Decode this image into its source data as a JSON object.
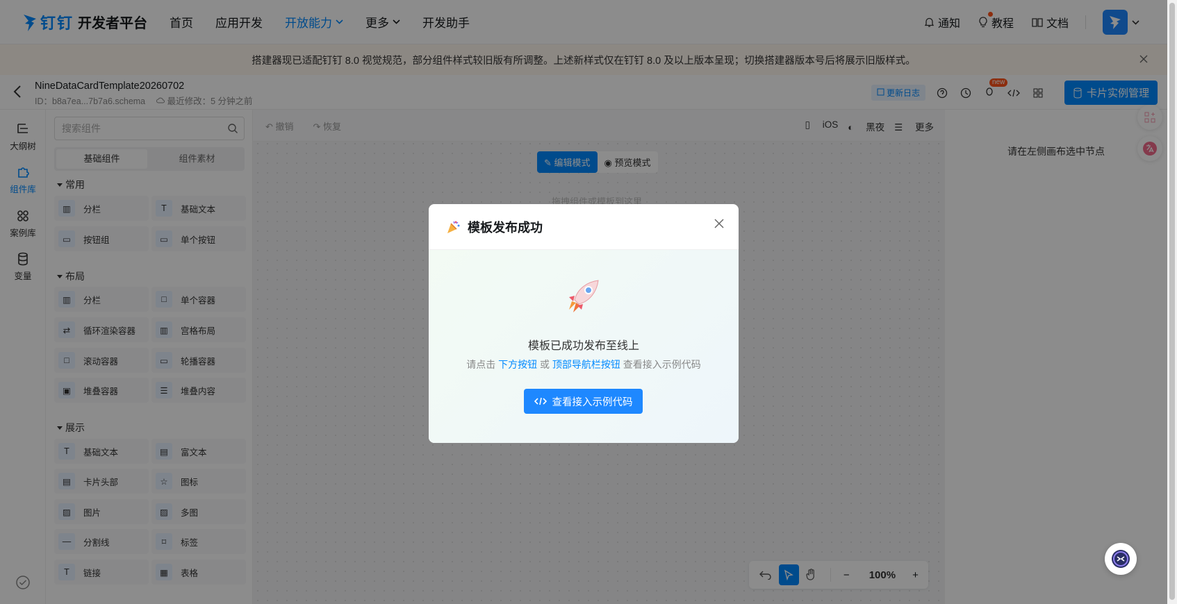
{
  "nav": {
    "brand": "钉钉",
    "title": "开发者平台",
    "items": [
      {
        "label": "首页"
      },
      {
        "label": "应用开发"
      },
      {
        "label": "开放能力"
      },
      {
        "label": "更多"
      },
      {
        "label": "开发助手"
      }
    ],
    "right": {
      "notify": "通知",
      "tutorial": "教程",
      "docs": "文档"
    }
  },
  "banner": {
    "text": "搭建器现已适配钉钉 8.0 视觉规范，部分组件样式较旧版有所调整。上述新样式仅在钉钉 8.0 及以上版本呈现；切换搭建器版本号后将展示旧版样式。"
  },
  "editor": {
    "title": "NineDataCardTemplate20260702",
    "id_text": "ID：b8a7ea...7b7a6.schema",
    "modified": "最近修改：5 分钟之前",
    "changelog": "更新日志",
    "new_badge": "new",
    "manage_button": "卡片实例管理"
  },
  "rail": [
    {
      "label": "大纲树"
    },
    {
      "label": "组件库"
    },
    {
      "label": "案例库"
    },
    {
      "label": "变量"
    }
  ],
  "panel": {
    "search_placeholder": "搜索组件",
    "tabs": [
      "基础组件",
      "组件素材"
    ],
    "sections": [
      {
        "title": "常用",
        "items": [
          "分栏",
          "基础文本",
          "按钮组",
          "单个按钮"
        ]
      },
      {
        "title": "布局",
        "items": [
          "分栏",
          "单个容器",
          "循环渲染容器",
          "宫格布局",
          "滚动容器",
          "轮播容器",
          "堆叠容器",
          "堆叠内容"
        ]
      },
      {
        "title": "展示",
        "items": [
          "基础文本",
          "富文本",
          "卡片头部",
          "图标",
          "图片",
          "多图",
          "分割线",
          "标签",
          "链接",
          "表格"
        ]
      }
    ]
  },
  "canvas": {
    "undo": "撤销",
    "redo": "恢复",
    "platform": "iOS",
    "theme": "黑夜",
    "more": "更多",
    "mode_edit": "编辑模式",
    "mode_preview": "预览模式",
    "drop_hint": "拖拽组件或模板到这里",
    "zoom": "100%"
  },
  "props": {
    "hint": "请在左侧画布选中节点"
  },
  "modal": {
    "title": "模板发布成功",
    "message": "模板已成功发布至线上",
    "desc_prefix": "请点击 ",
    "desc_link1": "下方按钮",
    "desc_or": " 或 ",
    "desc_link2": "顶部导航栏按钮",
    "desc_suffix": " 查看接入示例代码",
    "button": "查看接入示例代码"
  },
  "colors": {
    "accent": "#0089ff",
    "banner_bg": "#fff7ef",
    "overlay": "rgba(0,0,0,0.45)"
  }
}
